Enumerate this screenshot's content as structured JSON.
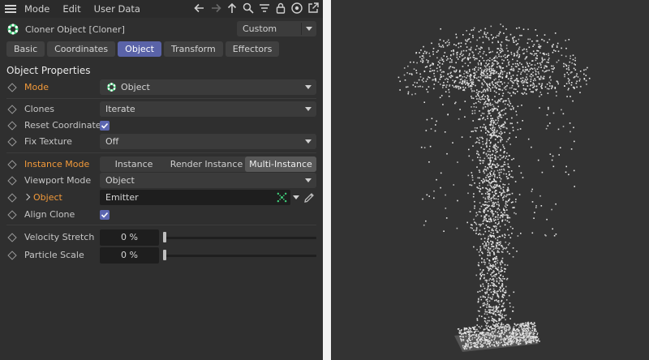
{
  "menu": {
    "items": [
      "Mode",
      "Edit",
      "User Data"
    ]
  },
  "header": {
    "title": "Cloner Object [Cloner]",
    "preset": "Custom"
  },
  "tabs": [
    "Basic",
    "Coordinates",
    "Object",
    "Transform",
    "Effectors"
  ],
  "section": {
    "title": "Object Properties"
  },
  "fields": {
    "mode": {
      "label": "Mode",
      "value": "Object"
    },
    "clones": {
      "label": "Clones",
      "value": "Iterate"
    },
    "reset_coordinates": {
      "label": "Reset Coordinates",
      "checked": true
    },
    "fix_texture": {
      "label": "Fix Texture",
      "value": "Off"
    },
    "instance_mode": {
      "label": "Instance Mode",
      "options": [
        "Instance",
        "Render Instance",
        "Multi-Instance"
      ],
      "selected": "Multi-Instance"
    },
    "viewport_mode": {
      "label": "Viewport Mode",
      "value": "Object"
    },
    "object": {
      "label": "Object",
      "value": "Emitter"
    },
    "align_clone": {
      "label": "Align Clone",
      "checked": true
    },
    "velocity_stretch": {
      "label": "Velocity Stretch",
      "value": "0 %",
      "slider": 0
    },
    "particle_scale": {
      "label": "Particle Scale",
      "value": "0 %",
      "slider": 0
    }
  },
  "colors": {
    "accent": "#5a63a8",
    "highlight_label": "#f39a3a",
    "icon_green": "#3fcf7a"
  },
  "icons": [
    "menu-icon",
    "back-arrow-icon",
    "forward-arrow-icon",
    "up-arrow-icon",
    "search-icon",
    "filter-icon",
    "lock-icon",
    "target-icon",
    "external-link-icon",
    "cloner-icon",
    "emitter-icon",
    "picker-icon"
  ]
}
